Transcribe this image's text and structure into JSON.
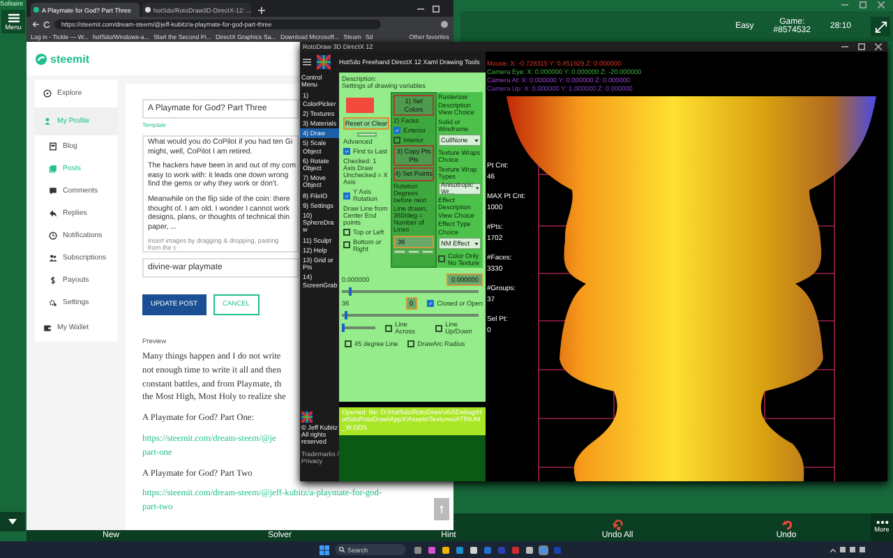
{
  "solitaire": {
    "title": "Solitaire",
    "menu_label": "Menu",
    "difficulty": "Easy",
    "game_label": "Game:",
    "game_number": "#8574532",
    "timer": "28:10",
    "actions": [
      {
        "kind": "plain",
        "label": "New"
      },
      {
        "kind": "plain",
        "label": "Solver"
      },
      {
        "kind": "plain",
        "label": "Hint"
      },
      {
        "kind": "undo-all",
        "label": "Undo All"
      },
      {
        "kind": "undo",
        "label": "Undo"
      },
      {
        "kind": "more",
        "label": "More"
      }
    ]
  },
  "browser": {
    "tabs": [
      {
        "title": "A Playmate for God? Part Three",
        "selected": true
      },
      {
        "title": "hotSdo/RotoDraw3D-DirectX-12: ...",
        "selected": false
      }
    ],
    "url": "https://steemit.com/dream-steem/@jeff-kubitz/a-playmate-for-god-part-three",
    "bookmarks": [
      "Log in - Tickle — W...",
      "hotSdo/Windows-a...",
      "Start the Second Pi...",
      "DirectX Graphics Sa...",
      "Download Microsoft...",
      "Steam",
      "Sd"
    ],
    "other_bookmarks": "Other favorites"
  },
  "steemit": {
    "logo": "steemit",
    "nav": [
      {
        "kind": "main",
        "label": "Explore",
        "selected": false
      },
      {
        "kind": "main",
        "label": "My Profile",
        "selected": true
      },
      {
        "kind": "sub",
        "label": "Blog",
        "selected": false
      },
      {
        "kind": "sub",
        "label": "Posts",
        "selected": true
      },
      {
        "kind": "sub",
        "label": "Comments",
        "selected": false
      },
      {
        "kind": "sub",
        "label": "Replies",
        "selected": false
      },
      {
        "kind": "sub",
        "label": "Notifications",
        "selected": false
      },
      {
        "kind": "sub",
        "label": "Subscriptions",
        "selected": false
      },
      {
        "kind": "sub",
        "label": "Payouts",
        "selected": false
      },
      {
        "kind": "sub",
        "label": "Settings",
        "selected": false
      },
      {
        "kind": "main",
        "label": "My Wallet",
        "selected": false
      }
    ],
    "editor": {
      "title": "A Playmate for God? Part Three",
      "template_link": "Template",
      "body_paragraphs": [
        [
          "What would you do CoPilot if you had ten Gi",
          "might, well, CoPilot I am retired."
        ],
        [
          "The hackers have been in and out of my com",
          "easy to work with: it leads one down wrong",
          "find the gems or why they work or don't."
        ],
        [
          "Meanwhile on the flip side of the coin: there",
          "thought of. I am old. I wonder I cannot work",
          "designs, plans, or thoughts of technical thin",
          "paper, ..."
        ]
      ],
      "body_hint": "Insert images by dragging & dropping, pasting from the c",
      "tags": "divine-war playmate",
      "buttons": [
        {
          "kind": "primary",
          "label": "UPDATE POST"
        },
        {
          "kind": "secondary",
          "label": "CANCEL"
        }
      ]
    },
    "preview": {
      "label": "Preview",
      "blocks": [
        {
          "kind": "text",
          "lines": [
            "Many things happen and I do not write",
            "not enough time to write it all and then",
            "constant battles, and from Playmate, th",
            "the Most High, Most Holy to realize she"
          ]
        },
        {
          "kind": "text",
          "lines": [
            "A Playmate for God? Part One:"
          ]
        },
        {
          "kind": "link",
          "lines": [
            "https://steemit.com/dream-steem/@je",
            "part-one"
          ]
        },
        {
          "kind": "text",
          "lines": [
            "A Playmate for God? Part Two"
          ]
        },
        {
          "kind": "link",
          "lines": [
            "https://steemit.com/dream-steem/@jeff-kubitz/a-playmate-for-god-",
            "part-two"
          ]
        }
      ]
    }
  },
  "rotodraw": {
    "window_title": "RotoDraw 3D DirectX 12",
    "header": "HotSdo Freehand DirectX 12 Xaml Drawing Tools",
    "menu_title": "Control Menu",
    "menu": [
      {
        "label": "1) ColorPicker",
        "selected": false
      },
      {
        "label": "2) Textures",
        "selected": false
      },
      {
        "label": "3) Materials",
        "selected": false
      },
      {
        "label": "4) Draw",
        "selected": true
      },
      {
        "label": "5) Scale Object",
        "selected": false
      },
      {
        "label": "6) Rotate Object",
        "selected": false
      },
      {
        "label": "7) Move Object",
        "selected": false
      },
      {
        "label": "8) FileIO",
        "selected": false
      },
      {
        "label": "9) Settings",
        "selected": false
      },
      {
        "label": "10) SphereDraw",
        "selected": false
      },
      {
        "label": "11) Sculpt",
        "selected": false
      },
      {
        "label": "12) Help",
        "selected": false
      },
      {
        "label": "13) Grid or Pts",
        "selected": false
      },
      {
        "label": "14) ScreenGrab",
        "selected": false
      }
    ],
    "copyright": "© Jeff Kubitz All rights reserved",
    "legal_link": "Trademarks / Privacy",
    "panel": {
      "description": "Description:",
      "subtitle": "Settings of drawing variables",
      "columns": [
        {
          "items": [
            {
              "kind": "swatch",
              "color": "#f24b3c"
            },
            {
              "kind": "outlined-button",
              "label": "Reset or Clear"
            },
            {
              "kind": "blank-button"
            },
            {
              "kind": "text",
              "label": "Advanced"
            },
            {
              "kind": "check",
              "label": "First to Last",
              "checked": true
            },
            {
              "kind": "text",
              "label": "Checked: 1 Axis Draw Unchecked = X Axis"
            },
            {
              "kind": "check",
              "label": "Y Axis Rotation",
              "checked": true
            },
            {
              "kind": "text",
              "label": "Draw Line from Center End points"
            },
            {
              "kind": "check",
              "label": "Top or Left",
              "checked": false
            },
            {
              "kind": "check",
              "label": "Bottom or Right",
              "checked": false
            }
          ]
        },
        {
          "items": [
            {
              "kind": "button",
              "label": "1) Set Colors"
            },
            {
              "kind": "text",
              "label": "2) Faces"
            },
            {
              "kind": "check",
              "label": "Exterior",
              "checked": true
            },
            {
              "kind": "check",
              "label": "Interior",
              "checked": false
            },
            {
              "kind": "button",
              "label": "3) Copy Pts Pts"
            },
            {
              "kind": "button",
              "label": "4) Set Points"
            },
            {
              "kind": "text",
              "label": "Rotation Degrees before next Line drawn, 360/deg = Number of Lines"
            },
            {
              "kind": "field",
              "value": "36"
            },
            {
              "kind": "blank-buttons"
            }
          ]
        },
        {
          "items": [
            {
              "kind": "text",
              "label": "Rasterizer Description View Choice"
            },
            {
              "kind": "text",
              "label": "Solid or Wireframe"
            },
            {
              "kind": "select",
              "value": "CullNone"
            },
            {
              "kind": "text",
              "label": "Texture Wraps Choice"
            },
            {
              "kind": "text",
              "label": "Texture Wrap Types"
            },
            {
              "kind": "select",
              "value": "Anisotropic Wr..."
            },
            {
              "kind": "text",
              "label": "Effect Description View Choice"
            },
            {
              "kind": "text",
              "label": "Effect Type Choice"
            },
            {
              "kind": "select",
              "value": "NM Effect"
            },
            {
              "kind": "check",
              "label": "Color Only No Texture",
              "checked": false
            }
          ]
        }
      ],
      "rows": [
        {
          "items": [
            {
              "kind": "text",
              "label": "0.000000"
            },
            {
              "kind": "field",
              "value": "0.000000"
            }
          ]
        },
        {
          "items": [
            {
              "kind": "slider",
              "level": 0.05
            }
          ]
        },
        {
          "items": [
            {
              "kind": "text",
              "label": "36"
            },
            {
              "kind": "field",
              "value": "0"
            },
            {
              "kind": "check",
              "label": "Closed or Open",
              "checked": true
            }
          ]
        },
        {
          "items": [
            {
              "kind": "slider",
              "level": 0.02
            }
          ]
        },
        {
          "items": [
            {
              "kind": "short-slider",
              "level": 0.02
            },
            {
              "kind": "check",
              "label": "Line Across",
              "checked": false
            },
            {
              "kind": "check",
              "label": "Line Up/Down",
              "checked": false
            }
          ]
        },
        {
          "items": [
            {
              "kind": "check",
              "label": "45 degree Line",
              "checked": false
            },
            {
              "kind": "check",
              "label": "DrawArc Radius",
              "checked": false
            }
          ]
        }
      ]
    },
    "status": "Opened: file: D:\\HotSdo\\RotoDraw\\x64\\Debug\\HotSdoRotoDraw\\AppX\\Assets\\Textures\\ATRIUM_W.DDS",
    "camera": [
      {
        "kind": "mouse",
        "text": "Mouse: X: -0.728315 Y: 0.851929 Z: 0.000000"
      },
      {
        "kind": "eye",
        "text": "Camera Eye: X: 0.000000 Y: 0.000000 Z: -20.000000"
      },
      {
        "kind": "at",
        "text": "Camera At: X: 0.000000 Y: 0.000000 Z: 0.000000"
      },
      {
        "kind": "up",
        "text": "Camera Up: X: 0.000000 Y: 1.000000 Z: 0.000000"
      }
    ],
    "stats": [
      {
        "label": "Pt Cnt:",
        "value": "46"
      },
      {
        "label": "MAX Pt Cnt:",
        "value": "1000"
      },
      {
        "label": "#Pts:",
        "value": "1702"
      },
      {
        "label": "#Faces:",
        "value": "3330"
      },
      {
        "label": "#Groups:",
        "value": "37"
      },
      {
        "label": "Sel Pt:",
        "value": "0"
      }
    ]
  },
  "taskbar": {
    "search_placeholder": "Search"
  }
}
